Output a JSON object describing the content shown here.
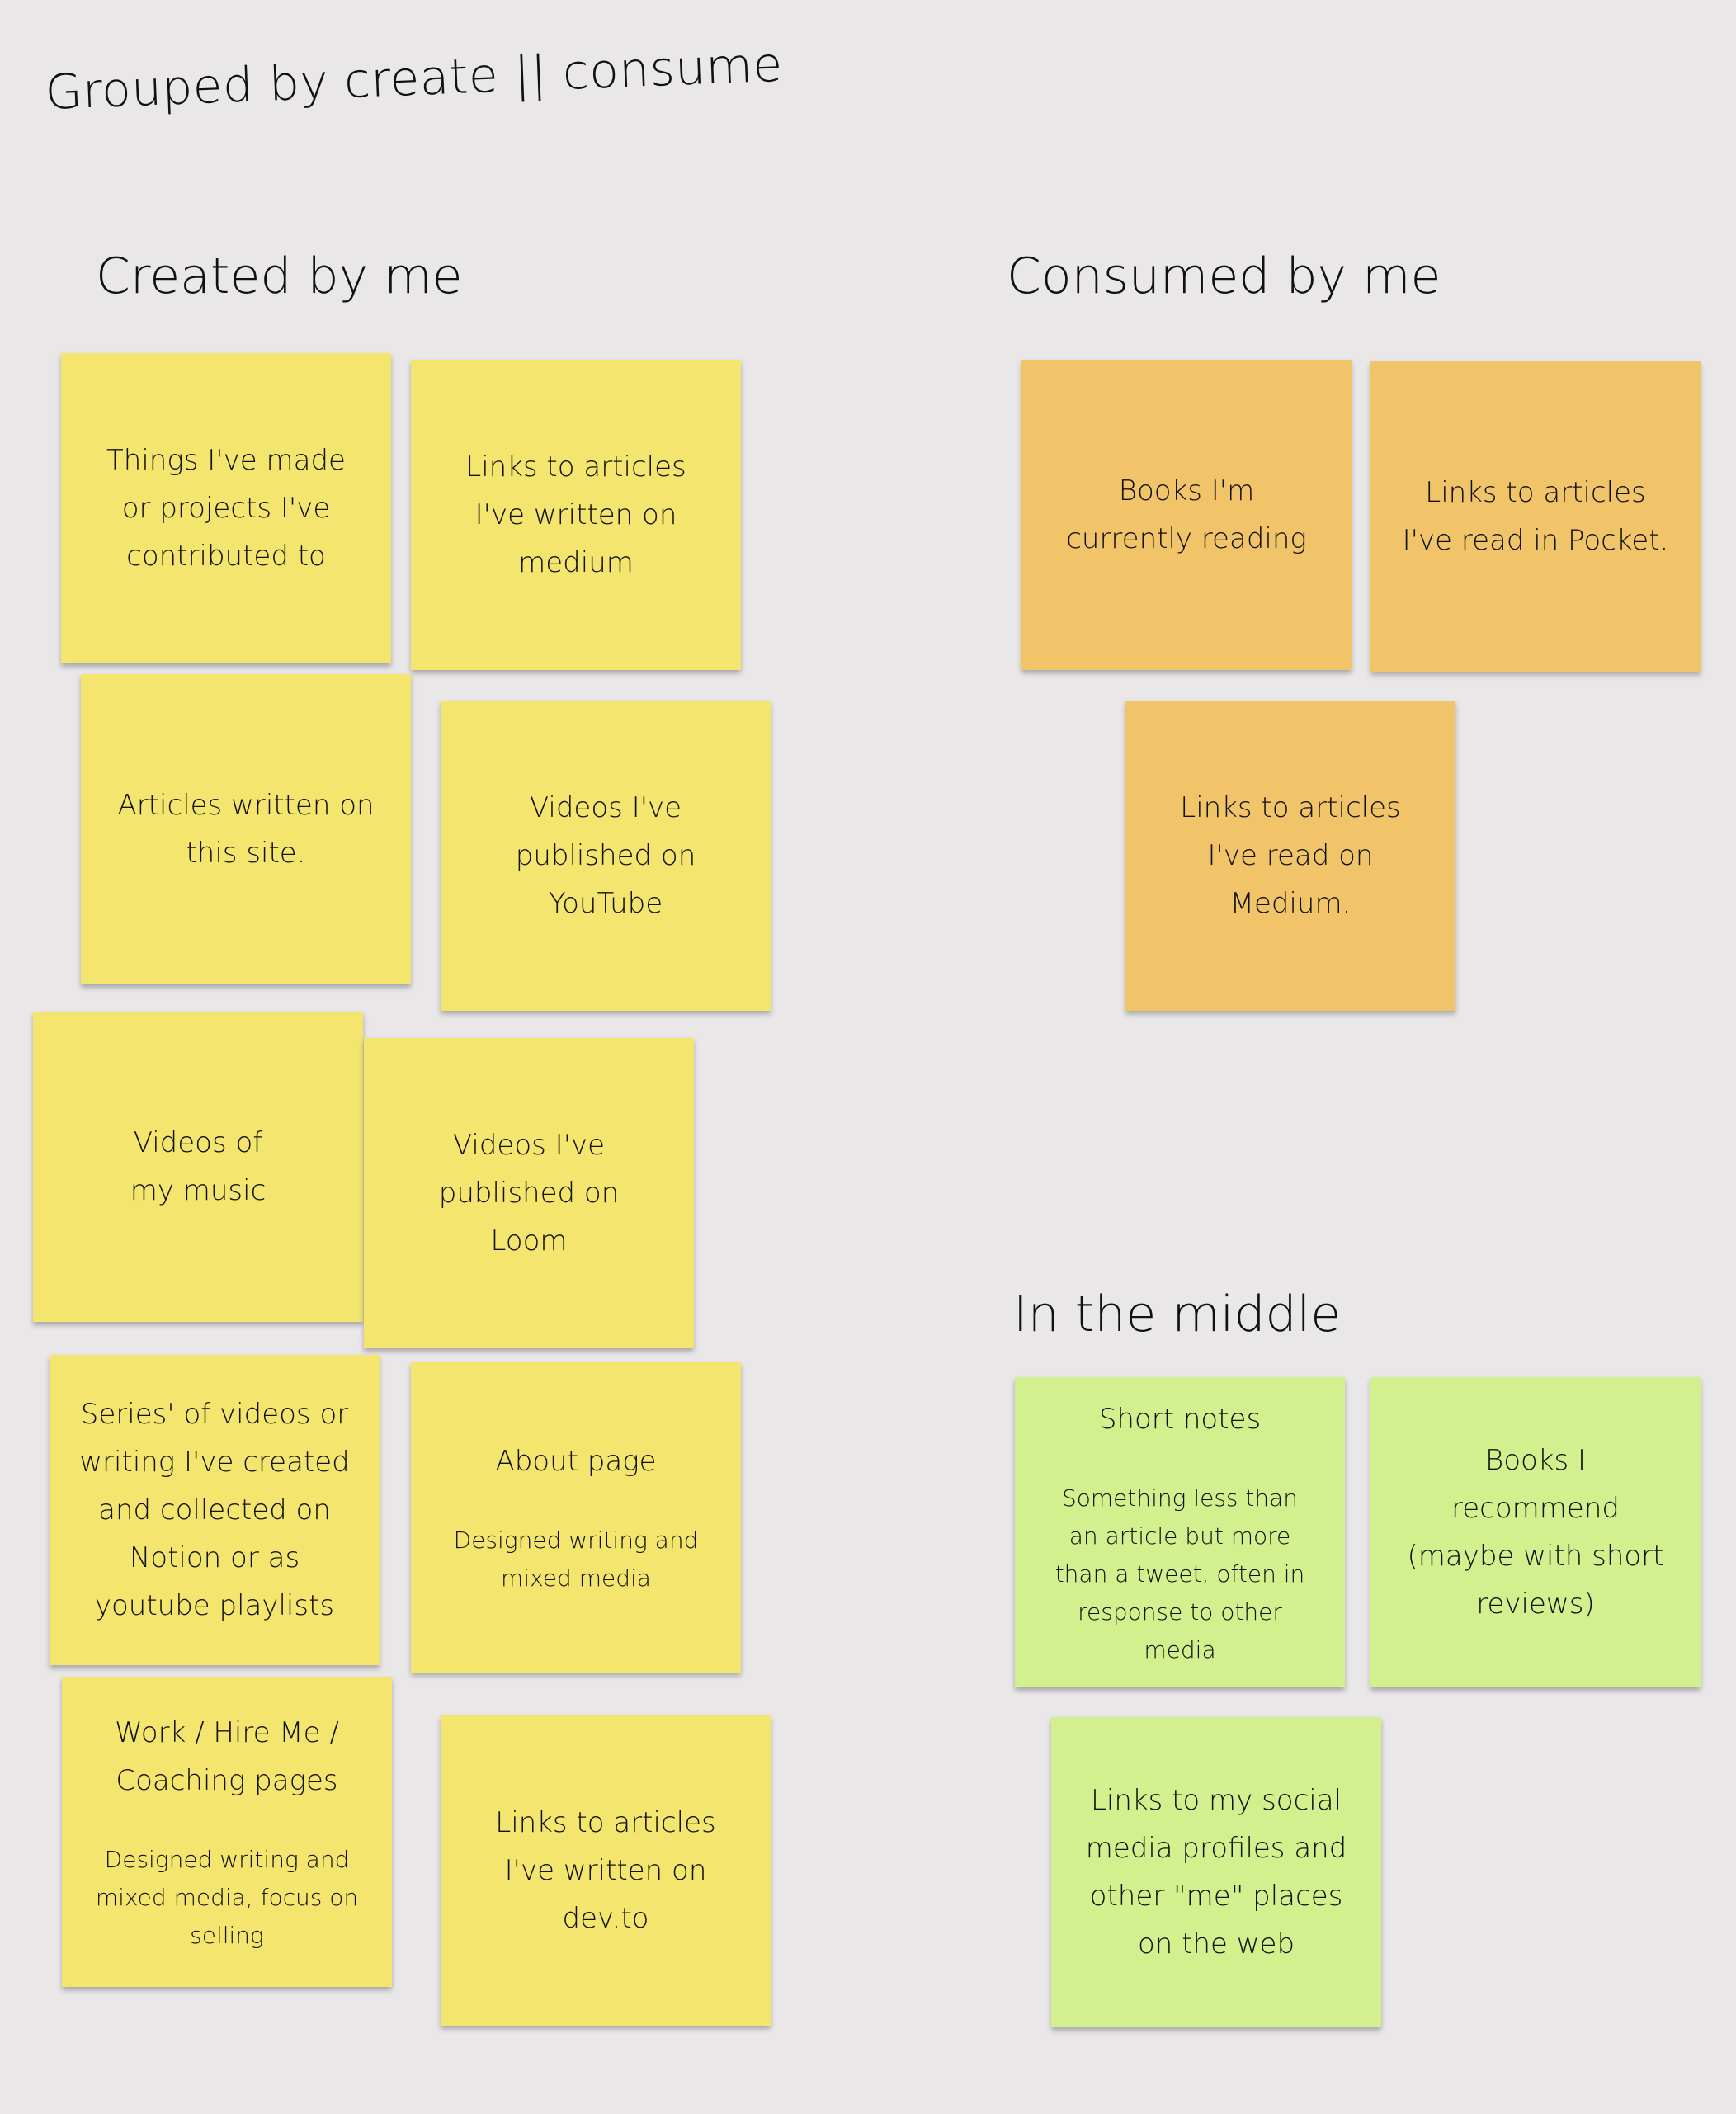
{
  "board": {
    "title": "Grouped by create || consume",
    "colors": {
      "background": "#e9e7e8",
      "created": "#f3e56e",
      "consumed": "#f1c46a",
      "middle": "#d2f08e"
    }
  },
  "sections": {
    "created": {
      "heading": "Created by me",
      "notes": [
        {
          "text": "Things I've made or projects I've contributed to"
        },
        {
          "text": "Links to articles I've written on medium"
        },
        {
          "text": "Articles written on this site."
        },
        {
          "text": "Videos I've published on YouTube"
        },
        {
          "text": "Videos of my music"
        },
        {
          "text": "Videos I've published on Loom"
        },
        {
          "text": "Series' of videos or writing I've created and collected on Notion or as youtube playlists"
        },
        {
          "text": "About page",
          "subtext": "Designed writing and mixed media"
        },
        {
          "text": "Work / Hire Me / Coaching pages",
          "subtext": "Designed writing and mixed media, focus on selling"
        },
        {
          "text": "Links to articles I've written on dev.to"
        }
      ]
    },
    "consumed": {
      "heading": "Consumed by me",
      "notes": [
        {
          "text": "Books I'm currently reading"
        },
        {
          "text": "Links to articles I've read in Pocket."
        },
        {
          "text": "Links to articles I've read on Medium."
        }
      ]
    },
    "middle": {
      "heading": "In the middle",
      "notes": [
        {
          "text": "Short notes",
          "subtext": "Something less than an article but more than a tweet, often in response to other media"
        },
        {
          "text": "Books I recommend (maybe with short reviews)"
        },
        {
          "text": "Links to my social media profiles and other \"me\" places on the web"
        }
      ]
    }
  }
}
